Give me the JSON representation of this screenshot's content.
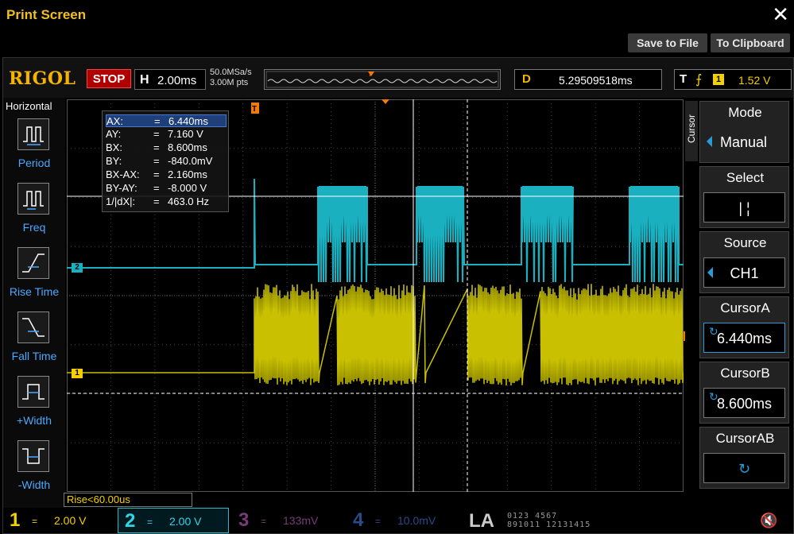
{
  "window": {
    "title": "Print Screen",
    "close_icon": "close-icon"
  },
  "actions": {
    "save_label": "Save to File",
    "clipboard_label": "To Clipboard"
  },
  "topbar": {
    "logo": "RIGOL",
    "run_state": "STOP",
    "timebase_key": "H",
    "timebase_value": "2.00ms",
    "sample_rate": "50.0MSa/s",
    "memory_depth": "3.00M pts",
    "delay_key": "D",
    "delay_value": "5.29509518ms",
    "trigger_key": "T",
    "trigger_edge_icon": "rising-edge-icon",
    "trigger_source": "1",
    "trigger_level": "1.52 V"
  },
  "left_panel": {
    "title": "Horizontal",
    "items": [
      {
        "label": "Period",
        "icon": "period-icon"
      },
      {
        "label": "Freq",
        "icon": "frequency-icon"
      },
      {
        "label": "Rise Time",
        "icon": "rise-time-icon"
      },
      {
        "label": "Fall Time",
        "icon": "fall-time-icon"
      },
      {
        "label": "+Width",
        "icon": "positive-width-icon"
      },
      {
        "label": "-Width",
        "icon": "negative-width-icon"
      }
    ]
  },
  "readout": {
    "rows": [
      {
        "k": "AX:",
        "eq": "=",
        "v": "6.440ms"
      },
      {
        "k": "AY:",
        "eq": "=",
        "v": "7.160 V"
      },
      {
        "k": "BX:",
        "eq": "=",
        "v": "8.600ms"
      },
      {
        "k": "BY:",
        "eq": "=",
        "v": "-840.0mV"
      },
      {
        "k": "BX-AX:",
        "eq": "=",
        "v": "2.160ms"
      },
      {
        "k": "BY-AY:",
        "eq": "=",
        "v": "-8.000 V"
      },
      {
        "k": "1/|dX|:",
        "eq": "=",
        "v": "463.0 Hz"
      }
    ]
  },
  "markers": {
    "ch2": "2",
    "ch1": "1",
    "trigger": "T"
  },
  "right_panel": {
    "tab": "Cursor",
    "mode_title": "Mode",
    "mode_value": "Manual",
    "select_title": "Select",
    "select_value": "|   ¦",
    "source_title": "Source",
    "source_value": "CH1",
    "cursora_title": "CursorA",
    "cursora_value": "6.440ms",
    "cursorb_title": "CursorB",
    "cursorb_value": "8.600ms",
    "cursorab_title": "CursorAB",
    "cursorab_value": "↻"
  },
  "status_note": "Rise<60.00us",
  "channels": [
    {
      "num": "1",
      "coupling": "=",
      "scale": "2.00 V",
      "color": "#f5d000"
    },
    {
      "num": "2",
      "coupling": "=",
      "scale": "2.00 V",
      "color": "#2ad8e8"
    },
    {
      "num": "3",
      "coupling": "=",
      "scale": "133mV",
      "color": "#7a3a7a"
    },
    {
      "num": "4",
      "coupling": "=",
      "scale": "10.0mV",
      "color": "#2a4a8a"
    }
  ],
  "la": {
    "label": "LA",
    "bits_top": "0123 4567",
    "bits_bottom": "891011 12131415"
  },
  "colors": {
    "ch1": "#c8c000",
    "ch2": "#1ab0c0",
    "accent": "#f5b400",
    "selected": "#2a9ad8"
  }
}
